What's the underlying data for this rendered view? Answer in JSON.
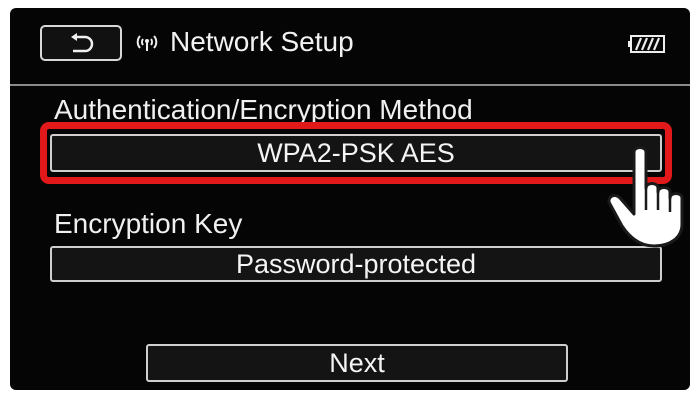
{
  "header": {
    "title": "Network Setup",
    "back_icon": "return-arrow-icon",
    "wifi_icon": "wifi-signal-icon",
    "battery_icon": "battery-full-icon"
  },
  "auth": {
    "label": "Authentication/Encryption Method",
    "value": "WPA2-PSK AES"
  },
  "key": {
    "label": "Encryption Key",
    "value": "Password-protected"
  },
  "actions": {
    "next_label": "Next"
  },
  "colors": {
    "highlight": "#e1191b",
    "screen_bg": "#050505",
    "text": "#f2f2f2"
  }
}
